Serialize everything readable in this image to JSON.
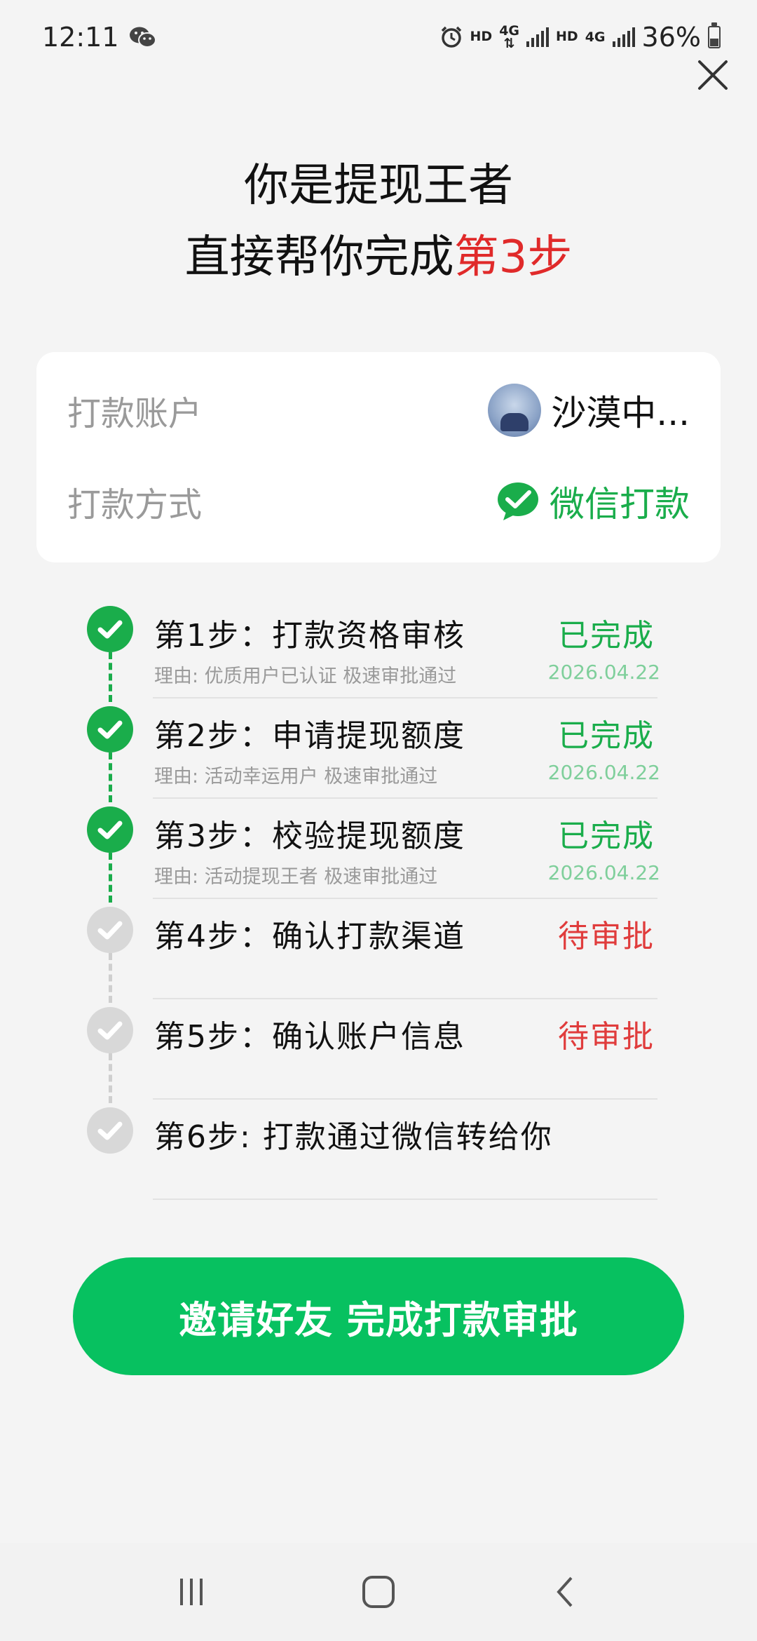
{
  "status_bar": {
    "time": "12:11",
    "hd1": "HD",
    "net1": "4G",
    "hd2": "HD",
    "net2": "4G",
    "battery": "36%"
  },
  "headline": {
    "line1": "你是提现王者",
    "line2_prefix": "直接帮你完成",
    "line2_highlight": "第3步"
  },
  "info_card": {
    "account_label": "打款账户",
    "account_value": "沙漠中...",
    "method_label": "打款方式",
    "method_value": "微信打款"
  },
  "steps": [
    {
      "title": "第1步：打款资格审核",
      "status": "已完成",
      "state": "done",
      "reason": "理由: 优质用户已认证 极速审批通过",
      "date": "2026.04.22"
    },
    {
      "title": "第2步：申请提现额度",
      "status": "已完成",
      "state": "done",
      "reason": "理由: 活动幸运用户 极速审批通过",
      "date": "2026.04.22"
    },
    {
      "title": "第3步：校验提现额度",
      "status": "已完成",
      "state": "done",
      "reason": "理由: 活动提现王者 极速审批通过",
      "date": "2026.04.22"
    },
    {
      "title": "第4步：确认打款渠道",
      "status": "待审批",
      "state": "pending",
      "reason": "",
      "date": ""
    },
    {
      "title": "第5步：确认账户信息",
      "status": "待审批",
      "state": "pending",
      "reason": "",
      "date": ""
    },
    {
      "title": "第6步: 打款通过微信转给你",
      "status": "",
      "state": "pending",
      "reason": "",
      "date": ""
    }
  ],
  "cta_label": "邀请好友 完成打款审批",
  "colors": {
    "accent_green": "#07c160",
    "done_green": "#1aad4b",
    "pending_red": "#e03c3c",
    "highlight_red": "#e02a2a"
  },
  "icons": [
    "wechat-icon",
    "alarm-icon",
    "signal-icon",
    "battery-icon",
    "close-icon",
    "check-icon",
    "recents-icon",
    "home-icon",
    "back-icon"
  ]
}
